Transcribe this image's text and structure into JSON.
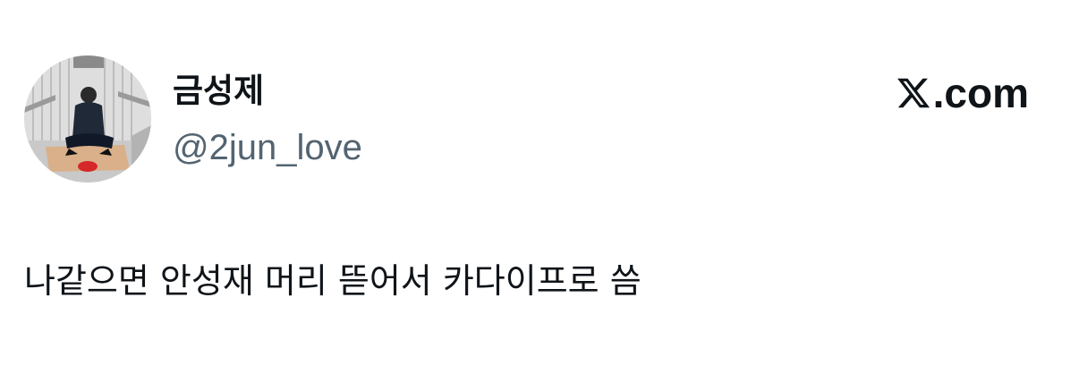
{
  "author": {
    "display_name": "금성제",
    "handle": "@2jun_love",
    "avatar_icon": "profile-photo"
  },
  "brand": {
    "logo_icon": "x-logo-icon",
    "domain": ".com"
  },
  "tweet": {
    "text": "나같으면 안성재 머리 뜯어서 카다이프로 씀"
  },
  "colors": {
    "text_primary": "#0f1419",
    "text_secondary": "#536471",
    "background": "#ffffff"
  }
}
